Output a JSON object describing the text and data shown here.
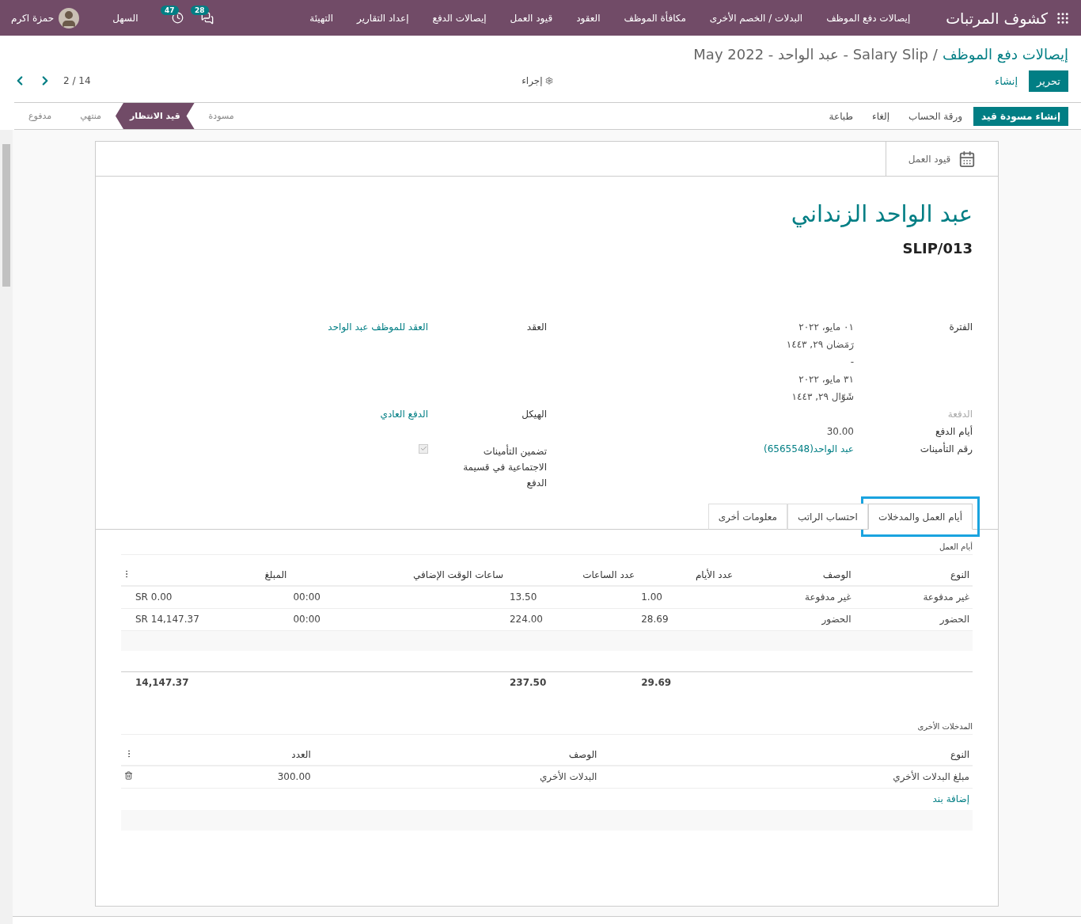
{
  "navbar": {
    "app_title": "كشوف المرتبات",
    "menu": [
      "إيصالات دفع الموظف",
      "البدلات / الخصم الأخرى",
      "مكافأة الموظف",
      "العقود",
      "قيود العمل",
      "إيصالات الدفع",
      "إعداد التقارير",
      "التهيئة"
    ],
    "messages_count": "28",
    "activities_count": "47",
    "company": "السهل",
    "user": "حمزة اكرم"
  },
  "breadcrumb": {
    "parent": "إيصالات دفع الموظف",
    "separator": "/",
    "current": "Salary Slip - عبد الواحد - May 2022"
  },
  "control_panel": {
    "buttons": [
      {
        "label": "تحرير",
        "kind": "primary"
      },
      {
        "label": "إنشاء",
        "kind": "link"
      }
    ],
    "action": "إجراء",
    "pager": "2 / 14"
  },
  "status_bar": {
    "buttons": [
      {
        "label": "إنشاء مسودة قيد",
        "kind": "primary"
      },
      {
        "label": "ورقة الحساب",
        "kind": "link"
      },
      {
        "label": "إلغاء",
        "kind": "link"
      },
      {
        "label": "طباعة",
        "kind": "link"
      }
    ],
    "stages": [
      {
        "label": "مسودة",
        "selected": false
      },
      {
        "label": "قيد الانتظار",
        "selected": true
      },
      {
        "label": "منتهي",
        "selected": false
      },
      {
        "label": "مدفوع",
        "selected": false
      }
    ]
  },
  "smart_button": {
    "label": "قيود العمل"
  },
  "employee_name": "عبد الواحد الزنداني",
  "reference": "SLIP/013",
  "field_rows": [
    {
      "start": {
        "kind": "lines",
        "label": "الفترة",
        "lines": [
          "٠١ مايو، ٢٠٢٢",
          "رَمَضان ٢٩, ١٤٤٣",
          "-",
          "٣١ مايو، ٢٠٢٢",
          "شَوّال ٢٩, ١٤٤٣"
        ]
      },
      "end": {
        "kind": "link",
        "label": "العقد",
        "value": "العقد للموظف عبد الواحد"
      }
    },
    {
      "start": {
        "kind": "section",
        "label": "الدفعة"
      },
      "end": {
        "kind": "link",
        "label": "الهيكل",
        "value": "الدفع العادي"
      }
    },
    {
      "start": {
        "kind": "text",
        "label": "أيام الدفع",
        "value": "30.00"
      }
    },
    {
      "start": {
        "kind": "link",
        "label": "رقم التأمينات",
        "value": "عبد الواحد(6565548)"
      },
      "end": {
        "kind": "checkbox",
        "label": "تضمين التأمينات الاجتماعية في قسيمة الدفع",
        "checked": true
      }
    }
  ],
  "tabs": [
    {
      "label": "أيام العمل والمدخلات",
      "selected": true,
      "highlighted": true
    },
    {
      "label": "احتساب الراتب",
      "selected": false,
      "highlighted": false
    },
    {
      "label": "معلومات أخرى",
      "selected": false,
      "highlighted": false
    }
  ],
  "worked_days": {
    "title": "أيام العمل",
    "columns": [
      "النوع",
      "الوصف",
      "عدد الأيام",
      "عدد الساعات",
      "ساعات الوقت الإضافي",
      "المبلغ"
    ],
    "rows": [
      [
        "غير مدفوعة",
        "غير مدفوعة",
        "1.00",
        "13.50",
        "00:00",
        "SR 0.00"
      ],
      [
        "الحضور",
        "الحضور",
        "28.69",
        "224.00",
        "00:00",
        "SR 14,147.37"
      ]
    ],
    "totals": {
      "days": "29.69",
      "hours": "237.50",
      "amount": "14,147.37"
    }
  },
  "other_inputs": {
    "title": "المدخلات الأخرى",
    "columns": [
      "النوع",
      "الوصف",
      "العدد"
    ],
    "rows": [
      [
        "مبلغ البدلات الأخري",
        "البدلات الأخري",
        "300.00"
      ]
    ],
    "add_line": "إضافة بند"
  }
}
